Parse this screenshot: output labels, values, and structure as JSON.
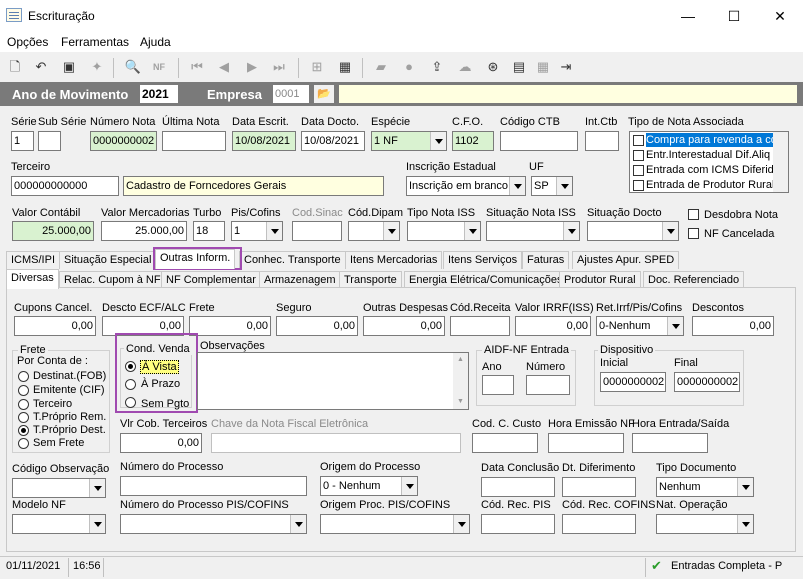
{
  "window": {
    "title": "Escrituração",
    "min": "—",
    "max": "☐",
    "close": "✕"
  },
  "menu": [
    "Opções",
    "Ferramentas",
    "Ajuda"
  ],
  "year": {
    "label": "Ano de Movimento",
    "value": "2021",
    "empresa_label": "Empresa",
    "empresa_value": "0001"
  },
  "row1": {
    "serie": "Série",
    "sub_serie": "Sub Série",
    "num_nota": "Número Nota",
    "ult_nota": "Última Nota",
    "data_escrit": "Data Escrit.",
    "data_docto": "Data Docto.",
    "especie": "Espécie",
    "cfo": "C.F.O.",
    "cod_ctb": "Código CTB",
    "int_ctb": "Int.Ctb",
    "tipo_nota": "Tipo de Nota Associada",
    "serie_v": "1",
    "num_nota_v": "0000000002",
    "data_escrit_v": "10/08/2021",
    "data_docto_v": "10/08/2021",
    "especie_v": "1   NF",
    "cfo_v": "1102"
  },
  "tipo_nota_list": [
    "Compra para revenda a co",
    "Entr.Interestadual Dif.Aliq",
    "Entrada com ICMS Diferido",
    "Entrada de Produtor Rural"
  ],
  "row2": {
    "terceiro": "Terceiro",
    "insc": "Inscrição Estadual",
    "uf": "UF",
    "terceiro_v": "000000000000",
    "terceiro_nome": "Cadastro de Forncedores Gerais",
    "insc_v": "Inscrição em branco",
    "uf_v": "SP"
  },
  "row3": {
    "valor_contabil": "Valor Contábil",
    "valor_merc": "Valor Mercadorias",
    "turbo": "Turbo",
    "pis": "Pis/Cofins",
    "cod_sinac": "Cod.Sinac",
    "cod_dipam": "Cód.Dipam",
    "tipo_iss": "Tipo Nota ISS",
    "sit_iss": "Situação Nota ISS",
    "sit_docto": "Situação Docto",
    "desdobra": "Desdobra Nota",
    "nf_cancelada": "NF Cancelada",
    "valor_contabil_v": "25.000,00",
    "valor_merc_v": "25.000,00",
    "turbo_v": "18",
    "pis_v": "1"
  },
  "tabs1": [
    "ICMS/IPI",
    "Situação Especial",
    "Outras Inform.",
    "Conhec. Transporte",
    "Itens Mercadorias",
    "Itens Serviços",
    "Faturas",
    "Ajustes Apur. SPED"
  ],
  "tabs2": [
    "Diversas",
    "Relac. Cupom à NF",
    "NF Complementar",
    "Armazenagem",
    "Transporte",
    "Energia Elétrica/Comunicações",
    "Produtor Rural",
    "Doc. Referenciado"
  ],
  "diversas": {
    "cupons": "Cupons Cancel.",
    "descto": "Descto ECF/ALC",
    "frete": "Frete",
    "seguro": "Seguro",
    "outras": "Outras Despesas",
    "cod_receita": "Cód.Receita",
    "valor_irrf": "Valor IRRF(ISS)",
    "ret_irrf": "Ret.Irrf/Pis/Cofins",
    "descontos": "Descontos",
    "zero": "0,00",
    "ret_irrf_v": "0-Nenhum"
  },
  "frete_group": {
    "title": "Frete",
    "por_conta": "Por Conta de :",
    "opts": [
      "Destinat.(FOB)",
      "Emitente (CIF)",
      "Terceiro",
      "T.Próprio Rem.",
      "T.Próprio Dest.",
      "Sem Frete"
    ]
  },
  "cond_venda": {
    "title": "Cond. Venda",
    "opts": [
      "À Vista",
      "À Prazo",
      "Sem Pgto"
    ]
  },
  "obs": "Observações",
  "aidf": {
    "title": "AIDF-NF Entrada",
    "ano": "Ano",
    "numero": "Número"
  },
  "dispositivo": {
    "title": "Dispositivo",
    "inicial": "Inicial",
    "final": "Final",
    "inicial_v": "0000000002",
    "final_v": "0000000002"
  },
  "row_cob": {
    "vlr_cob": "Vlr Cob. Terceiros",
    "chave": "Chave da Nota Fiscal Eletrônica",
    "cod_custo": "Cod. C. Custo",
    "hora_emissao": "Hora Emissão NF",
    "hora_entrada": "Hora Entrada/Saída",
    "vlr_cob_v": "0,00"
  },
  "row_obs": {
    "cod_obs": "Código Observação",
    "num_proc": "Número do Processo",
    "origem_proc": "Origem do Processo",
    "data_concl": "Data Conclusão",
    "dt_dif": "Dt. Diferimento",
    "tipo_doc": "Tipo Documento",
    "origem_v": "0 - Nenhum",
    "tipo_doc_v": "Nenhum"
  },
  "row_mod": {
    "modelo": "Modelo NF",
    "num_pis": "Número do Processo PIS/COFINS",
    "origem_pis": "Origem Proc. PIS/COFINS",
    "cod_rec_pis": "Cód. Rec. PIS",
    "cod_rec_cofins": "Cód. Rec. COFINS",
    "nat_op": "Nat. Operação"
  },
  "status": {
    "date": "01/11/2021",
    "time": "16:56",
    "mode": "Entradas Completa - P"
  }
}
